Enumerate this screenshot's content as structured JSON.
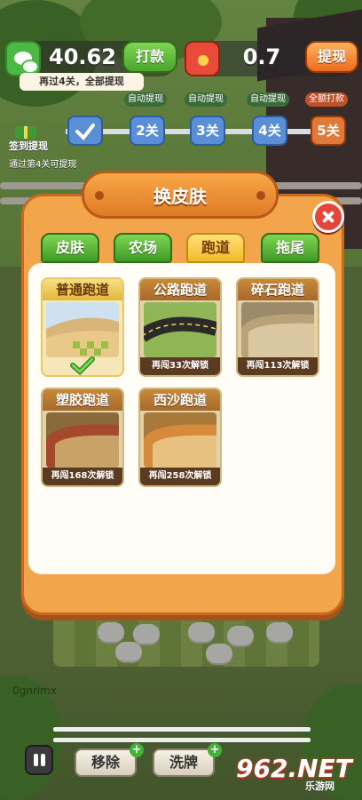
{
  "hud": {
    "balance": "40.62",
    "cash_button": "打款",
    "redpack_amount": "0.7",
    "withdraw_button": "提现",
    "banner": "再过4关，全部提现"
  },
  "levels": {
    "checkin_label": "签到提现",
    "checkin_sub": "通过第4关可提现",
    "nodes": [
      {
        "label": "2关",
        "tag": "自动提现"
      },
      {
        "label": "3关",
        "tag": "自动提现"
      },
      {
        "label": "4关",
        "tag": "自动提现"
      },
      {
        "label": "5关",
        "tag": "全额打款"
      }
    ]
  },
  "modal": {
    "title": "换皮肤",
    "tabs": [
      "皮肤",
      "农场",
      "跑道",
      "拖尾"
    ],
    "active_tab": "跑道",
    "cards": [
      {
        "name": "普通跑道",
        "status": "",
        "selected": true
      },
      {
        "name": "公路跑道",
        "status": "再闯33次解锁",
        "selected": false
      },
      {
        "name": "碎石跑道",
        "status": "再闯113次解锁",
        "selected": false
      },
      {
        "name": "塑胶跑道",
        "status": "再闯168次解锁",
        "selected": false
      },
      {
        "name": "西沙跑道",
        "status": "再闯258次解锁",
        "selected": false
      }
    ]
  },
  "bottom": {
    "user": "0gnrimx",
    "remove_button": "移除",
    "shuffle_button": "洗牌",
    "plus": "+"
  },
  "watermark": {
    "number": "962.NET",
    "site": "乐游网"
  },
  "colors": {
    "modal_orange": "#f2a54a",
    "tab_green": "#4ba52c",
    "tab_active_yellow": "#f2b928",
    "close_red": "#e5463a"
  }
}
